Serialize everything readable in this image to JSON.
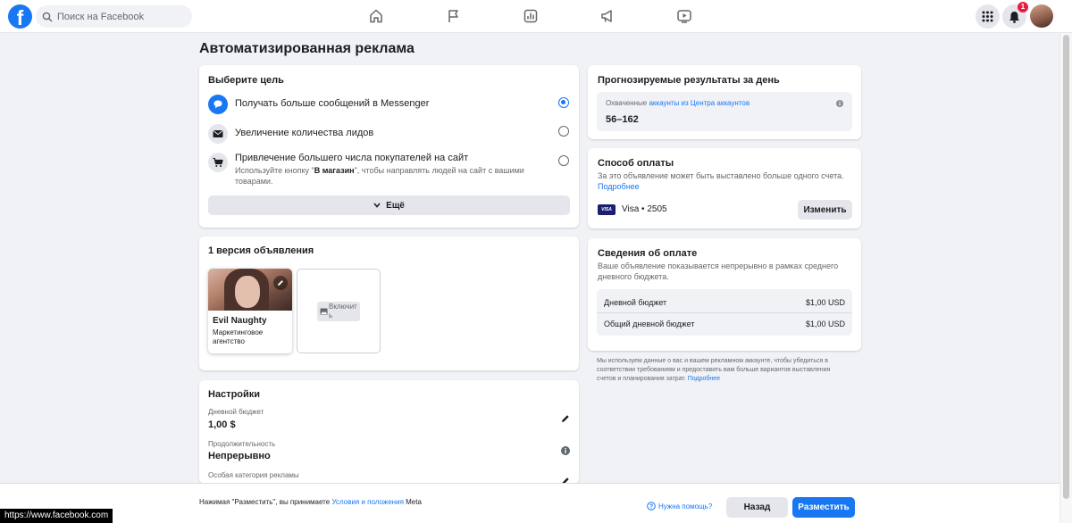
{
  "topbar": {
    "logo": "f",
    "search_placeholder": "Поиск на Facebook",
    "notification_count": "1",
    "nav_icons": [
      "home-icon",
      "flag-icon",
      "chart-icon",
      "megaphone-icon",
      "video-icon"
    ]
  },
  "page_title": "Автоматизированная реклама",
  "goal": {
    "title": "Выберите цель",
    "options": [
      {
        "label": "Получать больше сообщений в Messenger",
        "selected": true,
        "icon": "messenger-icon"
      },
      {
        "label": "Увеличение количества лидов",
        "selected": false,
        "icon": "envelope-icon"
      },
      {
        "label": "Привлечение большего числа покупателей на сайт",
        "sublabel_before": "Используйте кнопку \"",
        "sublabel_bold": "В магазин",
        "sublabel_after": "\", чтобы направлять людей на сайт с вашими товарами.",
        "selected": false,
        "icon": "cart-icon"
      }
    ],
    "more_label": "Ещё"
  },
  "ad_versions": {
    "title": "1 версия объявления",
    "tile": {
      "name": "Evil Naughty",
      "subtitle": "Маркетинговое агентство"
    },
    "add_label": "Включить"
  },
  "settings": {
    "title": "Настройки",
    "rows": [
      {
        "label": "Дневной бюджет",
        "value": "1,00 $",
        "action": "pencil-icon"
      },
      {
        "label": "Продолжительность",
        "value": "Непрерывно",
        "action": "info-icon"
      },
      {
        "label": "Особая категория рекламы",
        "value": "",
        "action": "pencil-icon"
      }
    ]
  },
  "forecast": {
    "title": "Прогнозируемые результаты за день",
    "reach_prefix": "Охваченные ",
    "reach_link": "аккаунты из Центра аккаунтов",
    "reach_value": "56–162"
  },
  "payment_method": {
    "title": "Способ оплаты",
    "desc": "За это объявление может быть выставлено больше одного счета.",
    "more_link": "Подробнее",
    "card_brand": "VISA",
    "card_label": "Visa • 2505",
    "change_label": "Изменить"
  },
  "payment_info": {
    "title": "Сведения об оплате",
    "desc": "Ваше объявление показывается непрерывно в рамках среднего дневного бюджета.",
    "rows": [
      {
        "label": "Дневной бюджет",
        "value": "$1,00 USD"
      },
      {
        "label": "Общий дневной бюджет",
        "value": "$1,00 USD"
      }
    ]
  },
  "disclaimer": {
    "text": "Мы используем данные о вас и вашем рекламном аккаунте, чтобы убедиться в соответствии требованиям и предоставить вам больше вариантов выставления счетов и планирования затрат.",
    "link": "Подробнее"
  },
  "bottom": {
    "terms_prefix": "Нажимая \"Разместить\", вы принимаете ",
    "terms_link": "Условия и положения",
    "terms_suffix": " Meta",
    "help_label": "Нужна помощь?",
    "back_label": "Назад",
    "publish_label": "Разместить"
  },
  "status_url": "https://www.facebook.com",
  "colors": {
    "accent": "#1877f2",
    "background": "#f0f2f5",
    "badge": "#e41e3f"
  }
}
